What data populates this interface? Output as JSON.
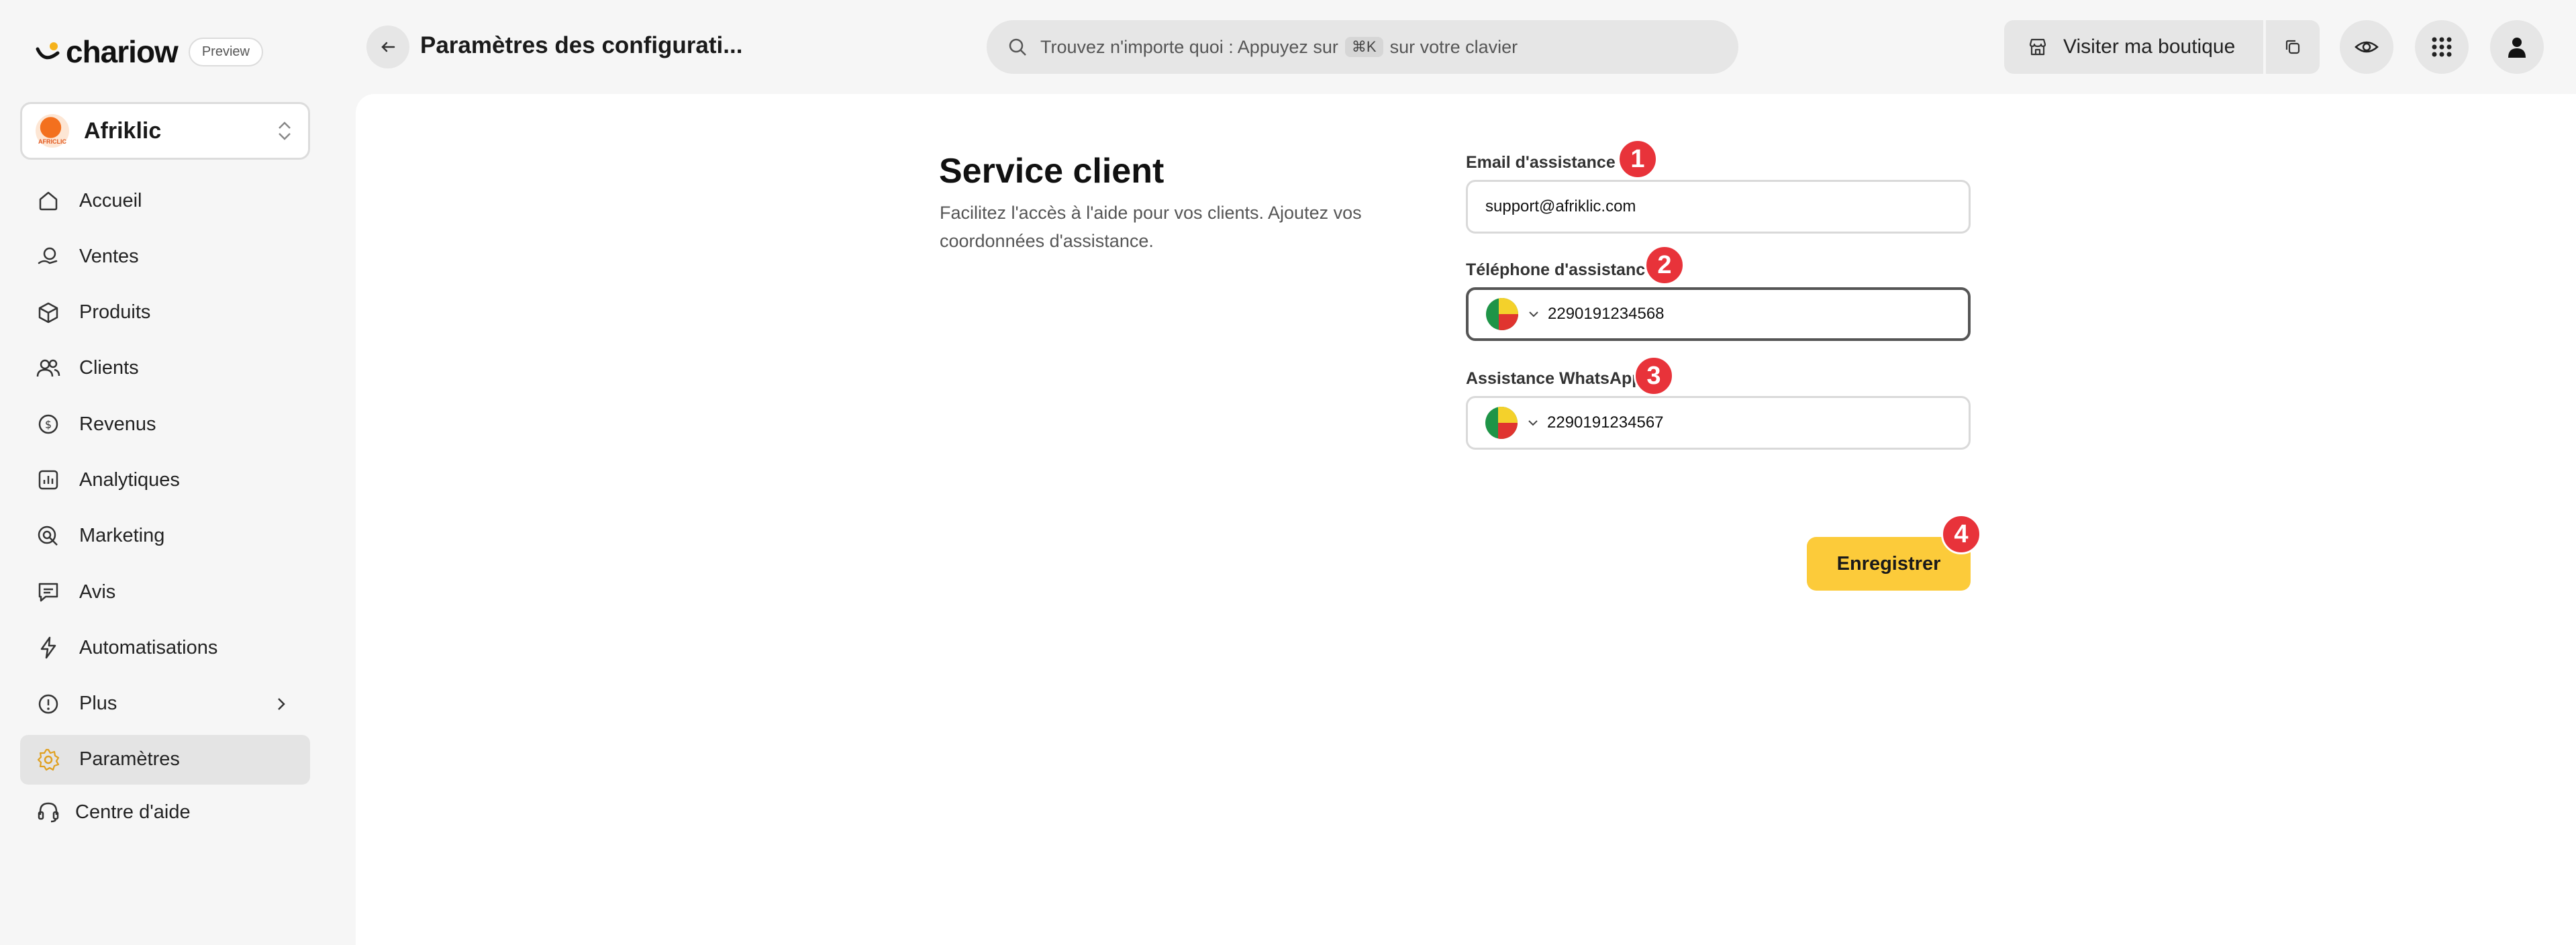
{
  "app": {
    "brand": "chariow",
    "preview_badge": "Preview"
  },
  "store": {
    "name": "Afriklic",
    "avatar_text": "AFRICLIC"
  },
  "sidebar": {
    "items": [
      {
        "label": "Accueil",
        "icon": "home-icon"
      },
      {
        "label": "Ventes",
        "icon": "sales-icon"
      },
      {
        "label": "Produits",
        "icon": "box-icon"
      },
      {
        "label": "Clients",
        "icon": "users-icon"
      },
      {
        "label": "Revenus",
        "icon": "dollar-icon"
      },
      {
        "label": "Analytiques",
        "icon": "chart-icon"
      },
      {
        "label": "Marketing",
        "icon": "target-icon"
      },
      {
        "label": "Avis",
        "icon": "review-icon"
      },
      {
        "label": "Automatisations",
        "icon": "lightning-icon"
      },
      {
        "label": "Plus",
        "icon": "info-icon"
      },
      {
        "label": "Paramètres",
        "icon": "gear-icon",
        "active": true
      }
    ],
    "help": "Centre d'aide"
  },
  "header": {
    "title": "Paramètres des configurati...",
    "search_prefix": "Trouvez n'importe quoi : Appuyez sur",
    "search_kbd": "⌘K",
    "search_suffix": "sur votre clavier",
    "visit_label": "Visiter ma boutique"
  },
  "main": {
    "title": "Service client",
    "description": "Facilitez l'accès à l'aide pour vos clients. Ajoutez vos coordonnées d'assistance.",
    "fields": {
      "email": {
        "label": "Email d'assistance",
        "required_mark": "*",
        "value": "support@afriklic.com",
        "marker": "1"
      },
      "phone": {
        "label": "Téléphone d'assistance",
        "value": "2290191234568",
        "marker": "2"
      },
      "whatsapp": {
        "label": "Assistance WhatsApp",
        "value": "2290191234567",
        "marker": "3"
      }
    },
    "save_label": "Enregistrer",
    "save_marker": "4"
  },
  "colors": {
    "accent": "#fccb3a",
    "marker": "#e8333a",
    "active_bg": "#e4e4e4"
  }
}
